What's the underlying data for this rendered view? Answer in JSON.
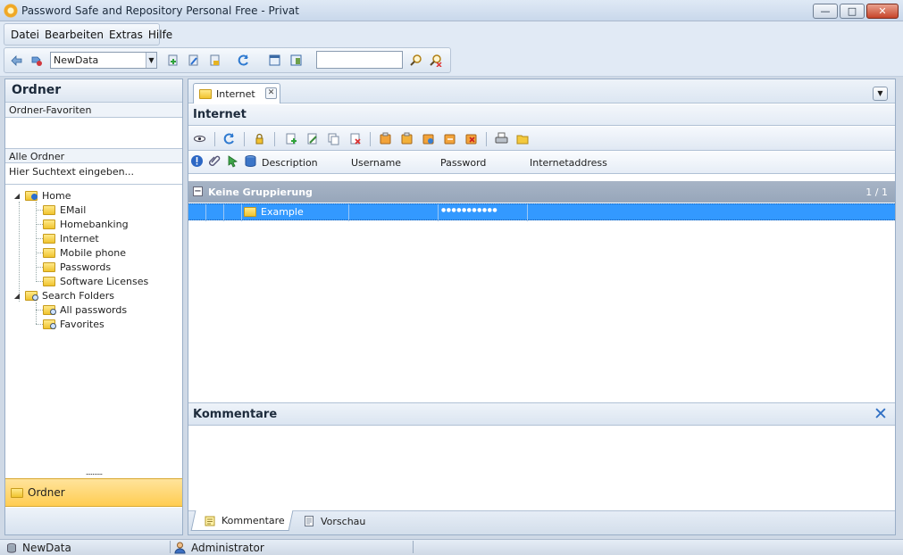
{
  "window": {
    "title": "Password Safe and Repository Personal Free - Privat",
    "min_glyph": "—",
    "max_glyph": "□",
    "close_glyph": "✕"
  },
  "menu": [
    "Datei",
    "Bearbeiten",
    "Extras",
    "Hilfe"
  ],
  "toolbar": {
    "database_select": "NewData",
    "search_value": ""
  },
  "left_panel": {
    "header": "Ordner",
    "favorites_label": "Ordner-Favoriten",
    "all_folders_label": "Alle Ordner",
    "search_placeholder": "Hier Suchtext eingeben...",
    "tree": {
      "home": "Home",
      "home_children": [
        "EMail",
        "Homebanking",
        "Internet",
        "Mobile phone",
        "Passwords",
        "Software Licenses"
      ],
      "search_folders": "Search Folders",
      "search_children": [
        "All passwords",
        "Favorites"
      ]
    },
    "grip": "..........",
    "nav_ordner": "Ordner"
  },
  "right_panel": {
    "tab_label": "Internet",
    "view_title": "Internet",
    "columns": [
      "Description",
      "Username",
      "Password",
      "Internetaddress"
    ],
    "group": {
      "label": "Keine Gruppierung",
      "count": "1 / 1",
      "toggle": "−"
    },
    "rows": [
      {
        "description": "Example",
        "username": "",
        "password": "●●●●●●●●●●●",
        "internetaddress": ""
      }
    ],
    "comment_header": "Kommentare",
    "bottom_tabs": [
      "Kommentare",
      "Vorschau"
    ]
  },
  "status_bar": {
    "database": "NewData",
    "user": "Administrator"
  },
  "colors": {
    "selection": "#3399ff",
    "nav_active": "#ffcd52",
    "group_header": "#9aa9bd"
  }
}
